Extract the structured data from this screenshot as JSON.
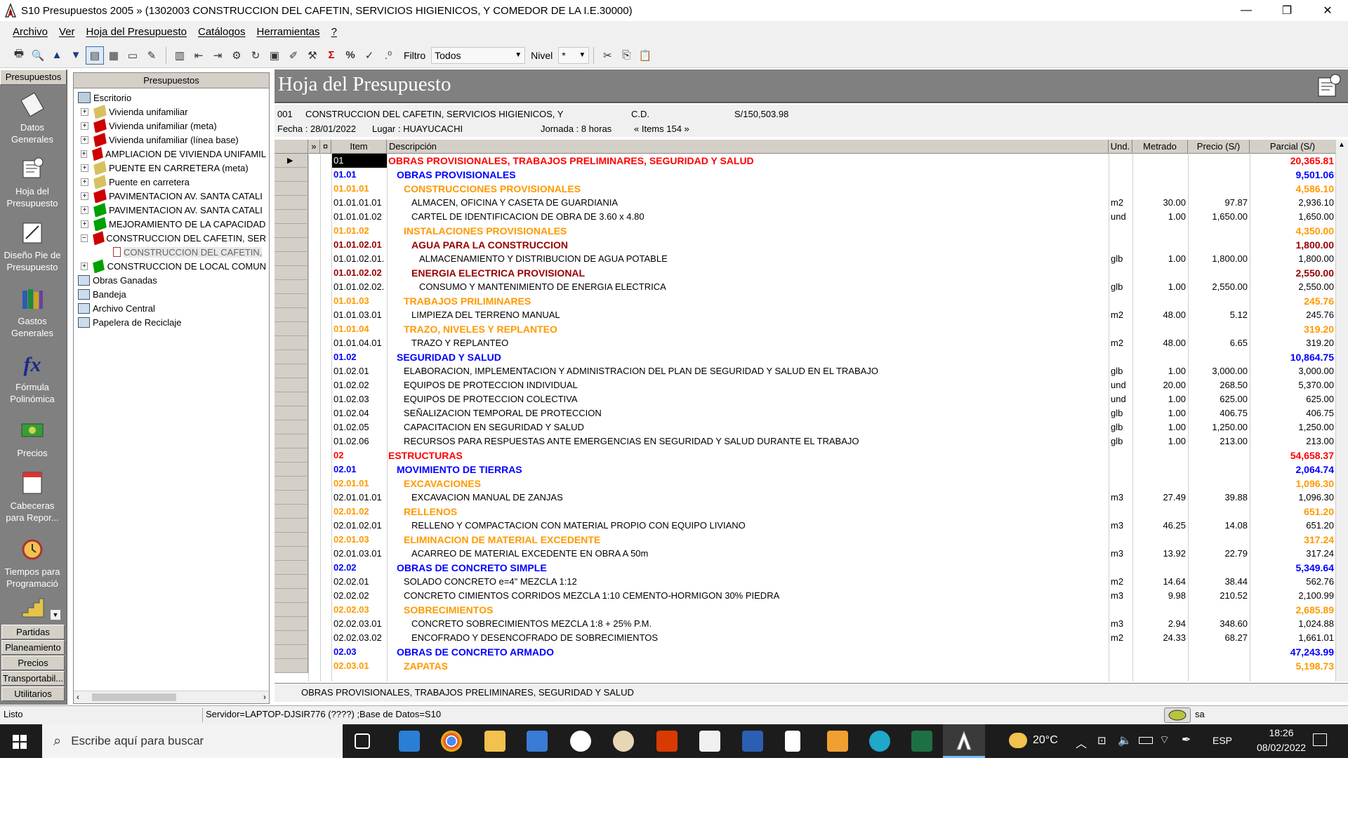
{
  "window": {
    "title": "S10 Presupuestos 2005 » (1302003 CONSTRUCCION DEL CAFETIN, SERVICIOS HIGIENICOS, Y COMEDOR DE LA I.E.30000)",
    "minimize": "—",
    "restore": "❐",
    "close": "✕"
  },
  "menu": {
    "items": [
      "Archivo",
      "Ver",
      "Hoja del Presupuesto",
      "Catálogos",
      "Herramientas",
      "?"
    ]
  },
  "toolbar": {
    "filtro_label": "Filtro",
    "filtro_value": "Todos",
    "nivel_label": "Nivel",
    "nivel_value": "*"
  },
  "leftbar": {
    "header": "Presupuestos",
    "items": [
      {
        "label": "Datos Generales",
        "icon": "datos-generales-icon"
      },
      {
        "label": "Hoja del Presupuesto",
        "icon": "hoja-presupuesto-icon"
      },
      {
        "label": "Diseño Pie de Presupuesto",
        "icon": "diseno-pie-icon"
      },
      {
        "label": "Gastos Generales",
        "icon": "gastos-generales-icon"
      },
      {
        "label": "Fórmula Polinómica",
        "icon": "formula-icon"
      },
      {
        "label": "Precios",
        "icon": "precios-icon"
      },
      {
        "label": "Cabeceras para Repor...",
        "icon": "nota-icon"
      },
      {
        "label": "Tiempos para Programació",
        "icon": "clock-icon"
      }
    ],
    "tabs": [
      "Partidas Ppta...",
      "Planeamiento",
      "Precios",
      "Transportabil...",
      "Utilitarios"
    ]
  },
  "tree": {
    "header": "Presupuestos",
    "root": "Escritorio",
    "nodes": [
      {
        "label": "Vivienda unifamiliar",
        "color": "#d8c060"
      },
      {
        "label": "Vivienda unifamiliar (meta)",
        "color": "#cc0000"
      },
      {
        "label": "Vivienda unifamiliar (línea base)",
        "color": "#cc0000"
      },
      {
        "label": "AMPLIACION DE VIVIENDA UNIFAMIL",
        "color": "#cc0000"
      },
      {
        "label": "PUENTE EN CARRETERA (meta)",
        "color": "#d8c060"
      },
      {
        "label": "Puente en carretera",
        "color": "#d8c060"
      },
      {
        "label": "PAVIMENTACION AV. SANTA CATALI",
        "color": "#cc0000"
      },
      {
        "label": "PAVIMENTACION AV. SANTA CATALI",
        "color": "#00a000"
      },
      {
        "label": "MEJORAMIENTO DE LA CAPACIDAD",
        "color": "#00a000"
      },
      {
        "label": "CONSTRUCCION DEL CAFETIN, SER",
        "color": "#cc0000"
      },
      {
        "label": "CONSTRUCCION DEL CAFETIN,",
        "color": "#888888"
      },
      {
        "label": "CONSTRUCCION DE LOCAL COMUN",
        "color": "#00a000"
      }
    ],
    "others": [
      "Obras Ganadas",
      "Bandeja",
      "Archivo Central",
      "Papelera de Reciclaje"
    ]
  },
  "main": {
    "title": "Hoja del Presupuesto",
    "code": "001",
    "project": "CONSTRUCCION DEL CAFETIN, SERVICIOS HIGIENICOS, Y",
    "cd": "C.D.",
    "amount": "S/150,503.98",
    "fecha": "Fecha : 28/01/2022",
    "lugar": "Lugar :  HUAYUCACHI",
    "jornada": "Jornada :  8    horas",
    "items": "« Items 154 »",
    "columns": [
      "»",
      "¤",
      "Item",
      "Descripción",
      "Und.",
      "Metrado",
      "Precio (S/)",
      "Parcial (S/)"
    ],
    "status_line": "OBRAS PROVISIONALES, TRABAJOS PRELIMINARES, SEGURIDAD Y SALUD",
    "rows": [
      {
        "item": "01",
        "desc": "OBRAS PROVISIONALES, TRABAJOS PRELIMINARES, SEGURIDAD Y SALUD",
        "und": "",
        "met": "",
        "pre": "",
        "par": "20,365.81",
        "lvl": 1
      },
      {
        "item": "01.01",
        "desc": "OBRAS PROVISIONALES",
        "und": "",
        "met": "",
        "pre": "",
        "par": "9,501.06",
        "lvl": 2
      },
      {
        "item": "01.01.01",
        "desc": "CONSTRUCCIONES PROVISIONALES",
        "und": "",
        "met": "",
        "pre": "",
        "par": "4,586.10",
        "lvl": 3
      },
      {
        "item": "01.01.01.01",
        "desc": "ALMACEN, OFICINA Y CASETA DE GUARDIANIA",
        "und": "m2",
        "met": "30.00",
        "pre": "97.87",
        "par": "2,936.10",
        "lvl": 0,
        "ind": 4
      },
      {
        "item": "01.01.01.02",
        "desc": "CARTEL DE IDENTIFICACION DE OBRA DE 3.60 x 4.80",
        "und": "und",
        "met": "1.00",
        "pre": "1,650.00",
        "par": "1,650.00",
        "lvl": 0,
        "ind": 4
      },
      {
        "item": "01.01.02",
        "desc": "INSTALACIONES PROVISIONALES",
        "und": "",
        "met": "",
        "pre": "",
        "par": "4,350.00",
        "lvl": 3
      },
      {
        "item": "01.01.02.01",
        "desc": "AGUA PARA LA CONSTRUCCION",
        "und": "",
        "met": "",
        "pre": "",
        "par": "1,800.00",
        "lvl": 4
      },
      {
        "item": "01.01.02.01.",
        "desc": "ALMACENAMIENTO Y DISTRIBUCION DE AGUA POTABLE",
        "und": "glb",
        "met": "1.00",
        "pre": "1,800.00",
        "par": "1,800.00",
        "lvl": 0,
        "ind": 5
      },
      {
        "item": "01.01.02.02",
        "desc": "ENERGIA ELECTRICA PROVISIONAL",
        "und": "",
        "met": "",
        "pre": "",
        "par": "2,550.00",
        "lvl": 4
      },
      {
        "item": "01.01.02.02.",
        "desc": "CONSUMO Y MANTENIMIENTO DE ENERGIA ELECTRICA",
        "und": "glb",
        "met": "1.00",
        "pre": "2,550.00",
        "par": "2,550.00",
        "lvl": 0,
        "ind": 5
      },
      {
        "item": "01.01.03",
        "desc": "TRABAJOS PRILIMINARES",
        "und": "",
        "met": "",
        "pre": "",
        "par": "245.76",
        "lvl": 3
      },
      {
        "item": "01.01.03.01",
        "desc": "LIMPIEZA DEL TERRENO MANUAL",
        "und": "m2",
        "met": "48.00",
        "pre": "5.12",
        "par": "245.76",
        "lvl": 0,
        "ind": 4
      },
      {
        "item": "01.01.04",
        "desc": "TRAZO, NIVELES Y REPLANTEO",
        "und": "",
        "met": "",
        "pre": "",
        "par": "319.20",
        "lvl": 3
      },
      {
        "item": "01.01.04.01",
        "desc": "TRAZO Y REPLANTEO",
        "und": "m2",
        "met": "48.00",
        "pre": "6.65",
        "par": "319.20",
        "lvl": 0,
        "ind": 4
      },
      {
        "item": "01.02",
        "desc": "SEGURIDAD Y SALUD",
        "und": "",
        "met": "",
        "pre": "",
        "par": "10,864.75",
        "lvl": 2
      },
      {
        "item": "01.02.01",
        "desc": "ELABORACION, IMPLEMENTACION Y ADMINISTRACION DEL PLAN DE SEGURIDAD Y SALUD EN EL TRABAJO",
        "und": "glb",
        "met": "1.00",
        "pre": "3,000.00",
        "par": "3,000.00",
        "lvl": 0,
        "ind": 3
      },
      {
        "item": "01.02.02",
        "desc": "EQUIPOS DE PROTECCION INDIVIDUAL",
        "und": "und",
        "met": "20.00",
        "pre": "268.50",
        "par": "5,370.00",
        "lvl": 0,
        "ind": 3
      },
      {
        "item": "01.02.03",
        "desc": "EQUIPOS DE PROTECCION COLECTIVA",
        "und": "und",
        "met": "1.00",
        "pre": "625.00",
        "par": "625.00",
        "lvl": 0,
        "ind": 3
      },
      {
        "item": "01.02.04",
        "desc": "SEÑALIZACION TEMPORAL DE PROTECCION",
        "und": "glb",
        "met": "1.00",
        "pre": "406.75",
        "par": "406.75",
        "lvl": 0,
        "ind": 3
      },
      {
        "item": "01.02.05",
        "desc": "CAPACITACION EN SEGURIDAD Y SALUD",
        "und": "glb",
        "met": "1.00",
        "pre": "1,250.00",
        "par": "1,250.00",
        "lvl": 0,
        "ind": 3
      },
      {
        "item": "01.02.06",
        "desc": "RECURSOS PARA RESPUESTAS ANTE EMERGENCIAS EN SEGURIDAD Y SALUD DURANTE EL TRABAJO",
        "und": "glb",
        "met": "1.00",
        "pre": "213.00",
        "par": "213.00",
        "lvl": 0,
        "ind": 3
      },
      {
        "item": "02",
        "desc": "ESTRUCTURAS",
        "und": "",
        "met": "",
        "pre": "",
        "par": "54,658.37",
        "lvl": 1
      },
      {
        "item": "02.01",
        "desc": "MOVIMIENTO DE TIERRAS",
        "und": "",
        "met": "",
        "pre": "",
        "par": "2,064.74",
        "lvl": 2
      },
      {
        "item": "02.01.01",
        "desc": "EXCAVACIONES",
        "und": "",
        "met": "",
        "pre": "",
        "par": "1,096.30",
        "lvl": 3
      },
      {
        "item": "02.01.01.01",
        "desc": "EXCAVACION MANUAL DE ZANJAS",
        "und": "m3",
        "met": "27.49",
        "pre": "39.88",
        "par": "1,096.30",
        "lvl": 0,
        "ind": 4
      },
      {
        "item": "02.01.02",
        "desc": "RELLENOS",
        "und": "",
        "met": "",
        "pre": "",
        "par": "651.20",
        "lvl": 3
      },
      {
        "item": "02.01.02.01",
        "desc": "RELLENO Y COMPACTACION CON MATERIAL PROPIO CON EQUIPO LIVIANO",
        "und": "m3",
        "met": "46.25",
        "pre": "14.08",
        "par": "651.20",
        "lvl": 0,
        "ind": 4
      },
      {
        "item": "02.01.03",
        "desc": "ELIMINACION DE MATERIAL EXCEDENTE",
        "und": "",
        "met": "",
        "pre": "",
        "par": "317.24",
        "lvl": 3
      },
      {
        "item": "02.01.03.01",
        "desc": "ACARREO DE MATERIAL EXCEDENTE EN OBRA A 50m",
        "und": "m3",
        "met": "13.92",
        "pre": "22.79",
        "par": "317.24",
        "lvl": 0,
        "ind": 4
      },
      {
        "item": "02.02",
        "desc": "OBRAS DE CONCRETO SIMPLE",
        "und": "",
        "met": "",
        "pre": "",
        "par": "5,349.64",
        "lvl": 2
      },
      {
        "item": "02.02.01",
        "desc": "SOLADO CONCRETO e=4\" MEZCLA 1:12",
        "und": "m2",
        "met": "14.64",
        "pre": "38.44",
        "par": "562.76",
        "lvl": 0,
        "ind": 3
      },
      {
        "item": "02.02.02",
        "desc": "CONCRETO CIMIENTOS CORRIDOS MEZCLA 1:10 CEMENTO-HORMIGON 30% PIEDRA",
        "und": "m3",
        "met": "9.98",
        "pre": "210.52",
        "par": "2,100.99",
        "lvl": 0,
        "ind": 3
      },
      {
        "item": "02.02.03",
        "desc": "SOBRECIMIENTOS",
        "und": "",
        "met": "",
        "pre": "",
        "par": "2,685.89",
        "lvl": 3
      },
      {
        "item": "02.02.03.01",
        "desc": "CONCRETO SOBRECIMIENTOS MEZCLA 1:8 + 25% P.M.",
        "und": "m3",
        "met": "2.94",
        "pre": "348.60",
        "par": "1,024.88",
        "lvl": 0,
        "ind": 4
      },
      {
        "item": "02.02.03.02",
        "desc": "ENCOFRADO Y DESENCOFRADO DE SOBRECIMIENTOS",
        "und": "m2",
        "met": "24.33",
        "pre": "68.27",
        "par": "1,661.01",
        "lvl": 0,
        "ind": 4
      },
      {
        "item": "02.03",
        "desc": "OBRAS DE CONCRETO ARMADO",
        "und": "",
        "met": "",
        "pre": "",
        "par": "47,243.99",
        "lvl": 2
      },
      {
        "item": "02.03.01",
        "desc": "ZAPATAS",
        "und": "",
        "met": "",
        "pre": "",
        "par": "5,198.73",
        "lvl": 3
      }
    ]
  },
  "status": {
    "left": "Listo",
    "server": "Servidor=LAPTOP-DJSIR776 (????) ;Base de Datos=S10",
    "user": "sa"
  },
  "taskbar": {
    "search": "Escribe aquí para buscar",
    "temp": "20°C",
    "lang": "ESP",
    "time": "18:26",
    "date": "08/02/2022"
  },
  "colors": {
    "lvl1": "#ff0000",
    "lvl2": "#0000ff",
    "lvl3": "#ff9900",
    "lvl4": "#990000",
    "normal": "#000000"
  }
}
